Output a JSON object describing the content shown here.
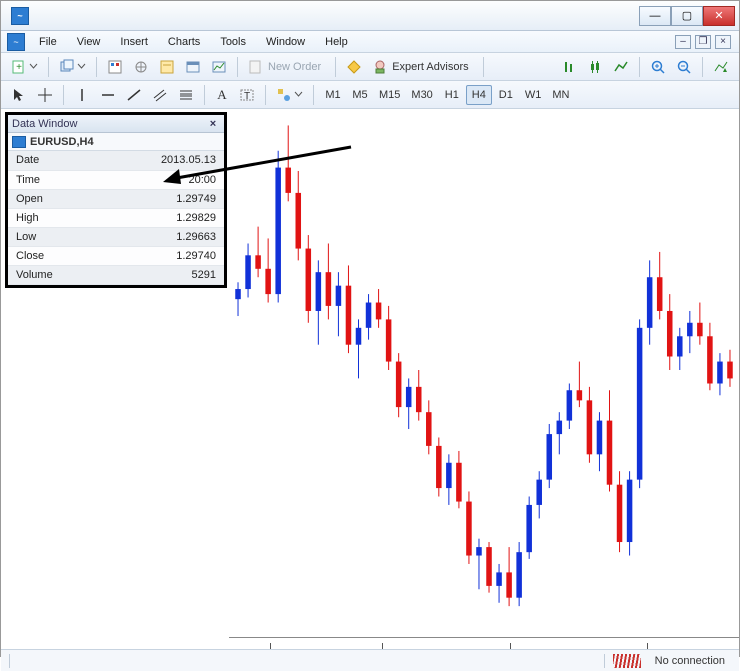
{
  "window": {
    "title": ""
  },
  "menu": {
    "items": [
      "File",
      "View",
      "Insert",
      "Charts",
      "Tools",
      "Window",
      "Help"
    ]
  },
  "toolbar1": {
    "new_order": "New Order",
    "expert_advisors": "Expert Advisors"
  },
  "toolbar2": {
    "timeframes": [
      "M1",
      "M5",
      "M15",
      "M30",
      "H1",
      "H4",
      "D1",
      "W1",
      "MN"
    ],
    "active_tf": "H4",
    "text_label": "A"
  },
  "data_window": {
    "title": "Data Window",
    "symbol": "EURUSD,H4",
    "rows": [
      {
        "k": "Date",
        "v": "2013.05.13"
      },
      {
        "k": "Time",
        "v": "20:00"
      },
      {
        "k": "Open",
        "v": "1.29749"
      },
      {
        "k": "High",
        "v": "1.29829"
      },
      {
        "k": "Low",
        "v": "1.29663"
      },
      {
        "k": "Close",
        "v": "1.29740"
      },
      {
        "k": "Volume",
        "v": "5291"
      }
    ]
  },
  "annotation": {
    "label": "Data Window"
  },
  "status": {
    "connection": "No connection"
  },
  "chart_data": {
    "type": "candlestick",
    "symbol": "EURUSD",
    "timeframe": "H4",
    "y_range": [
      1.278,
      1.308
    ],
    "candles": [
      {
        "o": 1.2972,
        "h": 1.2982,
        "l": 1.2962,
        "c": 1.2978,
        "color": "blue"
      },
      {
        "o": 1.2978,
        "h": 1.3005,
        "l": 1.2973,
        "c": 1.2998,
        "color": "blue"
      },
      {
        "o": 1.2998,
        "h": 1.3015,
        "l": 1.2985,
        "c": 1.299,
        "color": "red"
      },
      {
        "o": 1.299,
        "h": 1.3008,
        "l": 1.297,
        "c": 1.2975,
        "color": "red"
      },
      {
        "o": 1.2975,
        "h": 1.306,
        "l": 1.297,
        "c": 1.305,
        "color": "blue"
      },
      {
        "o": 1.305,
        "h": 1.3075,
        "l": 1.303,
        "c": 1.3035,
        "color": "red"
      },
      {
        "o": 1.3035,
        "h": 1.3048,
        "l": 1.2995,
        "c": 1.3002,
        "color": "red"
      },
      {
        "o": 1.3002,
        "h": 1.301,
        "l": 1.2958,
        "c": 1.2965,
        "color": "red"
      },
      {
        "o": 1.2965,
        "h": 1.2995,
        "l": 1.2945,
        "c": 1.2988,
        "color": "blue"
      },
      {
        "o": 1.2988,
        "h": 1.3005,
        "l": 1.296,
        "c": 1.2968,
        "color": "red"
      },
      {
        "o": 1.2968,
        "h": 1.2988,
        "l": 1.295,
        "c": 1.298,
        "color": "blue"
      },
      {
        "o": 1.298,
        "h": 1.2992,
        "l": 1.294,
        "c": 1.2945,
        "color": "red"
      },
      {
        "o": 1.2945,
        "h": 1.296,
        "l": 1.2925,
        "c": 1.2955,
        "color": "blue"
      },
      {
        "o": 1.2955,
        "h": 1.2975,
        "l": 1.2948,
        "c": 1.297,
        "color": "blue"
      },
      {
        "o": 1.297,
        "h": 1.2978,
        "l": 1.2955,
        "c": 1.296,
        "color": "red"
      },
      {
        "o": 1.296,
        "h": 1.2968,
        "l": 1.293,
        "c": 1.2935,
        "color": "red"
      },
      {
        "o": 1.2935,
        "h": 1.294,
        "l": 1.2902,
        "c": 1.2908,
        "color": "red"
      },
      {
        "o": 1.2908,
        "h": 1.2925,
        "l": 1.2895,
        "c": 1.292,
        "color": "blue"
      },
      {
        "o": 1.292,
        "h": 1.293,
        "l": 1.29,
        "c": 1.2905,
        "color": "red"
      },
      {
        "o": 1.2905,
        "h": 1.2912,
        "l": 1.288,
        "c": 1.2885,
        "color": "red"
      },
      {
        "o": 1.2885,
        "h": 1.289,
        "l": 1.2855,
        "c": 1.286,
        "color": "red"
      },
      {
        "o": 1.286,
        "h": 1.288,
        "l": 1.285,
        "c": 1.2875,
        "color": "blue"
      },
      {
        "o": 1.2875,
        "h": 1.2882,
        "l": 1.2848,
        "c": 1.2852,
        "color": "red"
      },
      {
        "o": 1.2852,
        "h": 1.2858,
        "l": 1.2815,
        "c": 1.282,
        "color": "red"
      },
      {
        "o": 1.282,
        "h": 1.283,
        "l": 1.28,
        "c": 1.2825,
        "color": "blue"
      },
      {
        "o": 1.2825,
        "h": 1.2828,
        "l": 1.2798,
        "c": 1.2802,
        "color": "red"
      },
      {
        "o": 1.2802,
        "h": 1.2815,
        "l": 1.2792,
        "c": 1.281,
        "color": "blue"
      },
      {
        "o": 1.281,
        "h": 1.2825,
        "l": 1.279,
        "c": 1.2795,
        "color": "red"
      },
      {
        "o": 1.2795,
        "h": 1.2828,
        "l": 1.279,
        "c": 1.2822,
        "color": "blue"
      },
      {
        "o": 1.2822,
        "h": 1.2855,
        "l": 1.2818,
        "c": 1.285,
        "color": "blue"
      },
      {
        "o": 1.285,
        "h": 1.287,
        "l": 1.2842,
        "c": 1.2865,
        "color": "blue"
      },
      {
        "o": 1.2865,
        "h": 1.2898,
        "l": 1.286,
        "c": 1.2892,
        "color": "blue"
      },
      {
        "o": 1.2892,
        "h": 1.2905,
        "l": 1.288,
        "c": 1.29,
        "color": "blue"
      },
      {
        "o": 1.29,
        "h": 1.2922,
        "l": 1.2895,
        "c": 1.2918,
        "color": "blue"
      },
      {
        "o": 1.2918,
        "h": 1.2935,
        "l": 1.2908,
        "c": 1.2912,
        "color": "red"
      },
      {
        "o": 1.2912,
        "h": 1.292,
        "l": 1.2875,
        "c": 1.288,
        "color": "red"
      },
      {
        "o": 1.288,
        "h": 1.2905,
        "l": 1.287,
        "c": 1.29,
        "color": "blue"
      },
      {
        "o": 1.29,
        "h": 1.2918,
        "l": 1.2858,
        "c": 1.2862,
        "color": "red"
      },
      {
        "o": 1.2862,
        "h": 1.287,
        "l": 1.2822,
        "c": 1.2828,
        "color": "red"
      },
      {
        "o": 1.2828,
        "h": 1.287,
        "l": 1.282,
        "c": 1.2865,
        "color": "blue"
      },
      {
        "o": 1.2865,
        "h": 1.296,
        "l": 1.286,
        "c": 1.2955,
        "color": "blue"
      },
      {
        "o": 1.2955,
        "h": 1.2995,
        "l": 1.2945,
        "c": 1.2985,
        "color": "blue"
      },
      {
        "o": 1.2985,
        "h": 1.3,
        "l": 1.296,
        "c": 1.2965,
        "color": "red"
      },
      {
        "o": 1.2965,
        "h": 1.2975,
        "l": 1.293,
        "c": 1.2938,
        "color": "red"
      },
      {
        "o": 1.2938,
        "h": 1.2955,
        "l": 1.293,
        "c": 1.295,
        "color": "blue"
      },
      {
        "o": 1.295,
        "h": 1.2965,
        "l": 1.294,
        "c": 1.2958,
        "color": "blue"
      },
      {
        "o": 1.2958,
        "h": 1.297,
        "l": 1.2945,
        "c": 1.295,
        "color": "red"
      },
      {
        "o": 1.295,
        "h": 1.2958,
        "l": 1.2918,
        "c": 1.2922,
        "color": "red"
      },
      {
        "o": 1.2922,
        "h": 1.294,
        "l": 1.2915,
        "c": 1.2935,
        "color": "blue"
      },
      {
        "o": 1.2935,
        "h": 1.2942,
        "l": 1.292,
        "c": 1.2925,
        "color": "red"
      }
    ]
  }
}
